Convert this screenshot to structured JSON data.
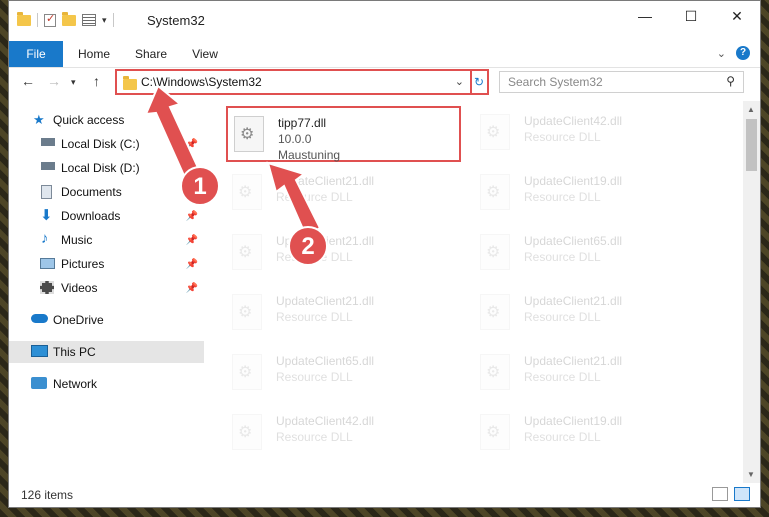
{
  "window": {
    "title": "System32",
    "minimize_icon": "minimize-icon",
    "maximize_icon": "maximize-icon",
    "close_icon": "close-icon"
  },
  "ribbon": {
    "tabs": [
      {
        "label": "File"
      },
      {
        "label": "Home"
      },
      {
        "label": "Share"
      },
      {
        "label": "View"
      }
    ],
    "help_label": "?"
  },
  "address": {
    "path": "C:\\Windows\\System32"
  },
  "search": {
    "placeholder": "Search System32"
  },
  "sidebar": {
    "items": [
      {
        "label": "Quick access",
        "icon": "star-icon"
      },
      {
        "label": "Local Disk (C:)",
        "icon": "drive-icon",
        "pinned": true
      },
      {
        "label": "Local Disk (D:)",
        "icon": "drive-icon"
      },
      {
        "label": "Documents",
        "icon": "documents-icon"
      },
      {
        "label": "Downloads",
        "icon": "download-icon",
        "pinned": true
      },
      {
        "label": "Music",
        "icon": "music-icon",
        "pinned": true
      },
      {
        "label": "Pictures",
        "icon": "pictures-icon",
        "pinned": true
      },
      {
        "label": "Videos",
        "icon": "videos-icon",
        "pinned": true
      },
      {
        "label": "OneDrive",
        "icon": "cloud-icon"
      },
      {
        "label": "This PC",
        "icon": "computer-icon",
        "selected": true
      },
      {
        "label": "Network",
        "icon": "network-icon"
      }
    ]
  },
  "files": [
    {
      "name": "tipp77.dll",
      "desc": "10.0.0",
      "meta": "Maustuning",
      "highlighted": true
    },
    {
      "name": "UpdateClient42.dll",
      "desc": "Resource DLL"
    },
    {
      "name": "UpdateClient21.dll",
      "desc": "Resource DLL"
    },
    {
      "name": "UpdateClient19.dll",
      "desc": "Resource DLL"
    },
    {
      "name": "UpdateClient21.dll",
      "desc": "Resource DLL"
    },
    {
      "name": "UpdateClient65.dll",
      "desc": "Resource DLL"
    },
    {
      "name": "UpdateClient21.dll",
      "desc": "Resource DLL"
    },
    {
      "name": "UpdateClient21.dll",
      "desc": "Resource DLL"
    },
    {
      "name": "UpdateClient65.dll",
      "desc": "Resource DLL"
    },
    {
      "name": "UpdateClient21.dll",
      "desc": "Resource DLL"
    },
    {
      "name": "UpdateClient42.dll",
      "desc": "Resource DLL"
    },
    {
      "name": "UpdateClient19.dll",
      "desc": "Resource DLL"
    }
  ],
  "status": {
    "count": "126 items"
  },
  "annotations": {
    "step1": "1",
    "step2": "2",
    "color": "#e05050"
  },
  "colors": {
    "accent": "#1979ca",
    "highlight": "#e05050"
  }
}
